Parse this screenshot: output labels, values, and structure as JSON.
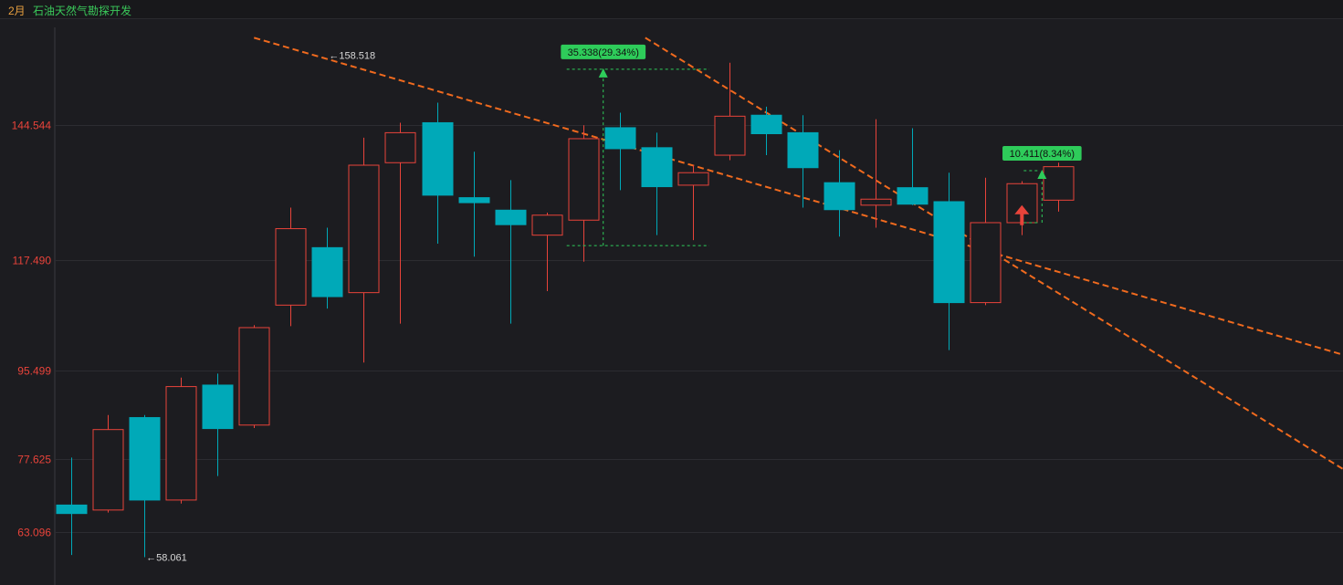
{
  "header": {
    "period": "2月",
    "stock_name": "石油天然气勘探开发"
  },
  "colors": {
    "up": "#e8433a",
    "down": "#00a9b8",
    "trend": "#f06a1e",
    "measure": "#2ecc5a",
    "grid": "#2c2c31"
  },
  "chart_data": {
    "type": "candlestick",
    "ylim": [
      52.5,
      165.9
    ],
    "y_ticks": [
      "144.544",
      "117.490",
      "95.499",
      "77.625",
      "63.096"
    ],
    "y_tick_values": [
      144.544,
      117.49,
      95.499,
      77.625,
      63.096
    ],
    "candles": [
      {
        "o": 68.5,
        "h": 78.0,
        "l": 58.5,
        "c": 66.8
      },
      {
        "o": 67.5,
        "h": 86.5,
        "l": 67.0,
        "c": 83.6
      },
      {
        "o": 86.0,
        "h": 86.5,
        "l": 58.061,
        "c": 69.5
      },
      {
        "o": 69.5,
        "h": 94.0,
        "l": 68.8,
        "c": 92.2
      },
      {
        "o": 92.5,
        "h": 94.8,
        "l": 74.3,
        "c": 83.8
      },
      {
        "o": 84.5,
        "h": 104.5,
        "l": 83.9,
        "c": 104.0
      },
      {
        "o": 108.5,
        "h": 128.0,
        "l": 104.3,
        "c": 123.8
      },
      {
        "o": 120.0,
        "h": 124.0,
        "l": 107.8,
        "c": 110.2
      },
      {
        "o": 111.0,
        "h": 142.0,
        "l": 97.0,
        "c": 136.5
      },
      {
        "o": 137.0,
        "h": 145.0,
        "l": 104.8,
        "c": 143.0
      },
      {
        "o": 145.0,
        "h": 149.0,
        "l": 120.8,
        "c": 130.5
      },
      {
        "o": 130.0,
        "h": 139.2,
        "l": 118.2,
        "c": 129.0
      },
      {
        "o": 127.5,
        "h": 133.5,
        "l": 104.8,
        "c": 124.6
      },
      {
        "o": 122.5,
        "h": 127.0,
        "l": 111.3,
        "c": 126.5
      },
      {
        "o": 125.5,
        "h": 144.5,
        "l": 117.2,
        "c": 141.8
      },
      {
        "o": 144.0,
        "h": 147.0,
        "l": 131.5,
        "c": 139.8
      },
      {
        "o": 140.0,
        "h": 143.0,
        "l": 122.5,
        "c": 132.2
      },
      {
        "o": 132.5,
        "h": 136.5,
        "l": 121.5,
        "c": 135.0
      },
      {
        "o": 138.5,
        "h": 157.0,
        "l": 137.5,
        "c": 146.3
      },
      {
        "o": 146.5,
        "h": 148.2,
        "l": 138.5,
        "c": 142.8
      },
      {
        "o": 143.0,
        "h": 146.5,
        "l": 128.0,
        "c": 136.0
      },
      {
        "o": 133.0,
        "h": 139.5,
        "l": 122.2,
        "c": 127.6
      },
      {
        "o": 128.5,
        "h": 145.7,
        "l": 124.0,
        "c": 129.7
      },
      {
        "o": 132.0,
        "h": 143.9,
        "l": 128.5,
        "c": 128.7
      },
      {
        "o": 129.2,
        "h": 135.0,
        "l": 99.5,
        "c": 109.0
      },
      {
        "o": 109.0,
        "h": 134.0,
        "l": 108.5,
        "c": 125.0
      },
      {
        "o": 125.0,
        "h": 133.3,
        "l": 122.5,
        "c": 132.8
      },
      {
        "o": 129.5,
        "h": 137.0,
        "l": 127.2,
        "c": 136.2
      }
    ],
    "annotations": {
      "high_label": "←158.518",
      "high_value": 158.518,
      "high_index": 7,
      "low_label": "←58.061",
      "low_value": 58.061,
      "low_index": 2,
      "measure1_label": "35.338(29.34%)",
      "measure1": {
        "from_index": 14,
        "to_index": 17,
        "y_from": 120.4,
        "y_to": 155.7
      },
      "measure2_label": "10.411(8.34%)",
      "measure2": {
        "from_index": 26,
        "to_index": 27,
        "y_from": 125.0,
        "y_to": 135.4
      }
    },
    "trendlines": [
      {
        "from": {
          "index": 5,
          "y": 162.0
        },
        "to": {
          "index": 35.8,
          "y": 96.4
        }
      },
      {
        "from": {
          "index": 15.7,
          "y": 162.0
        },
        "to": {
          "index": 35.8,
          "y": 71.1
        }
      }
    ]
  }
}
